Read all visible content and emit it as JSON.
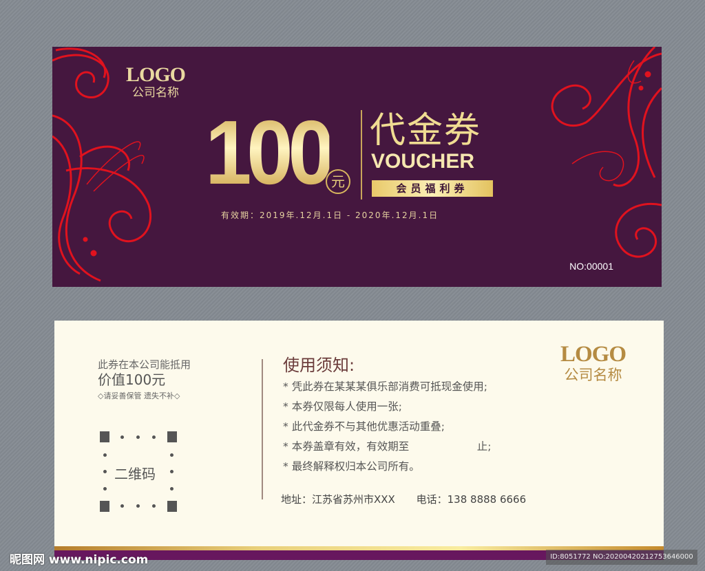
{
  "front": {
    "logo": {
      "text": "LOGO",
      "company": "公司名称"
    },
    "amount": "100",
    "currency": "元",
    "title_cn": "代金券",
    "title_en": "VOUCHER",
    "badge": "会员福利券",
    "validity": "有效期：2019年.12月.1日  -  2020年.12月.1日",
    "number": "NO:00001",
    "colors": {
      "background": "#45173f",
      "gold": "#f0dc92",
      "swirl": "#e0121e"
    }
  },
  "back": {
    "left": {
      "line1": "此券在本公司能抵用",
      "line2": "价值100元",
      "line3": "◇请妥善保管 遗失不补◇",
      "qr_label": "二维码"
    },
    "rules_title": "使用须知:",
    "rules": [
      "凭此券在某某某俱乐部消费可抵现金使用;",
      "本券仅限每人使用一张;",
      "此代金券不与其他优惠活动重叠;",
      "本券盖章有效，有效期至                    止;",
      "最终解释权归本公司所有。"
    ],
    "address": "地址：江苏省苏州市XXX",
    "phone": "电话：138 8888 6666",
    "logo": {
      "text": "LOGO",
      "company": "公司名称"
    },
    "colors": {
      "background": "#fdfaec",
      "accent": "#67175e"
    }
  },
  "watermark": {
    "site": "昵图网 www.nipic.com",
    "id": "ID:8051772 NO:20200420212753646000"
  }
}
